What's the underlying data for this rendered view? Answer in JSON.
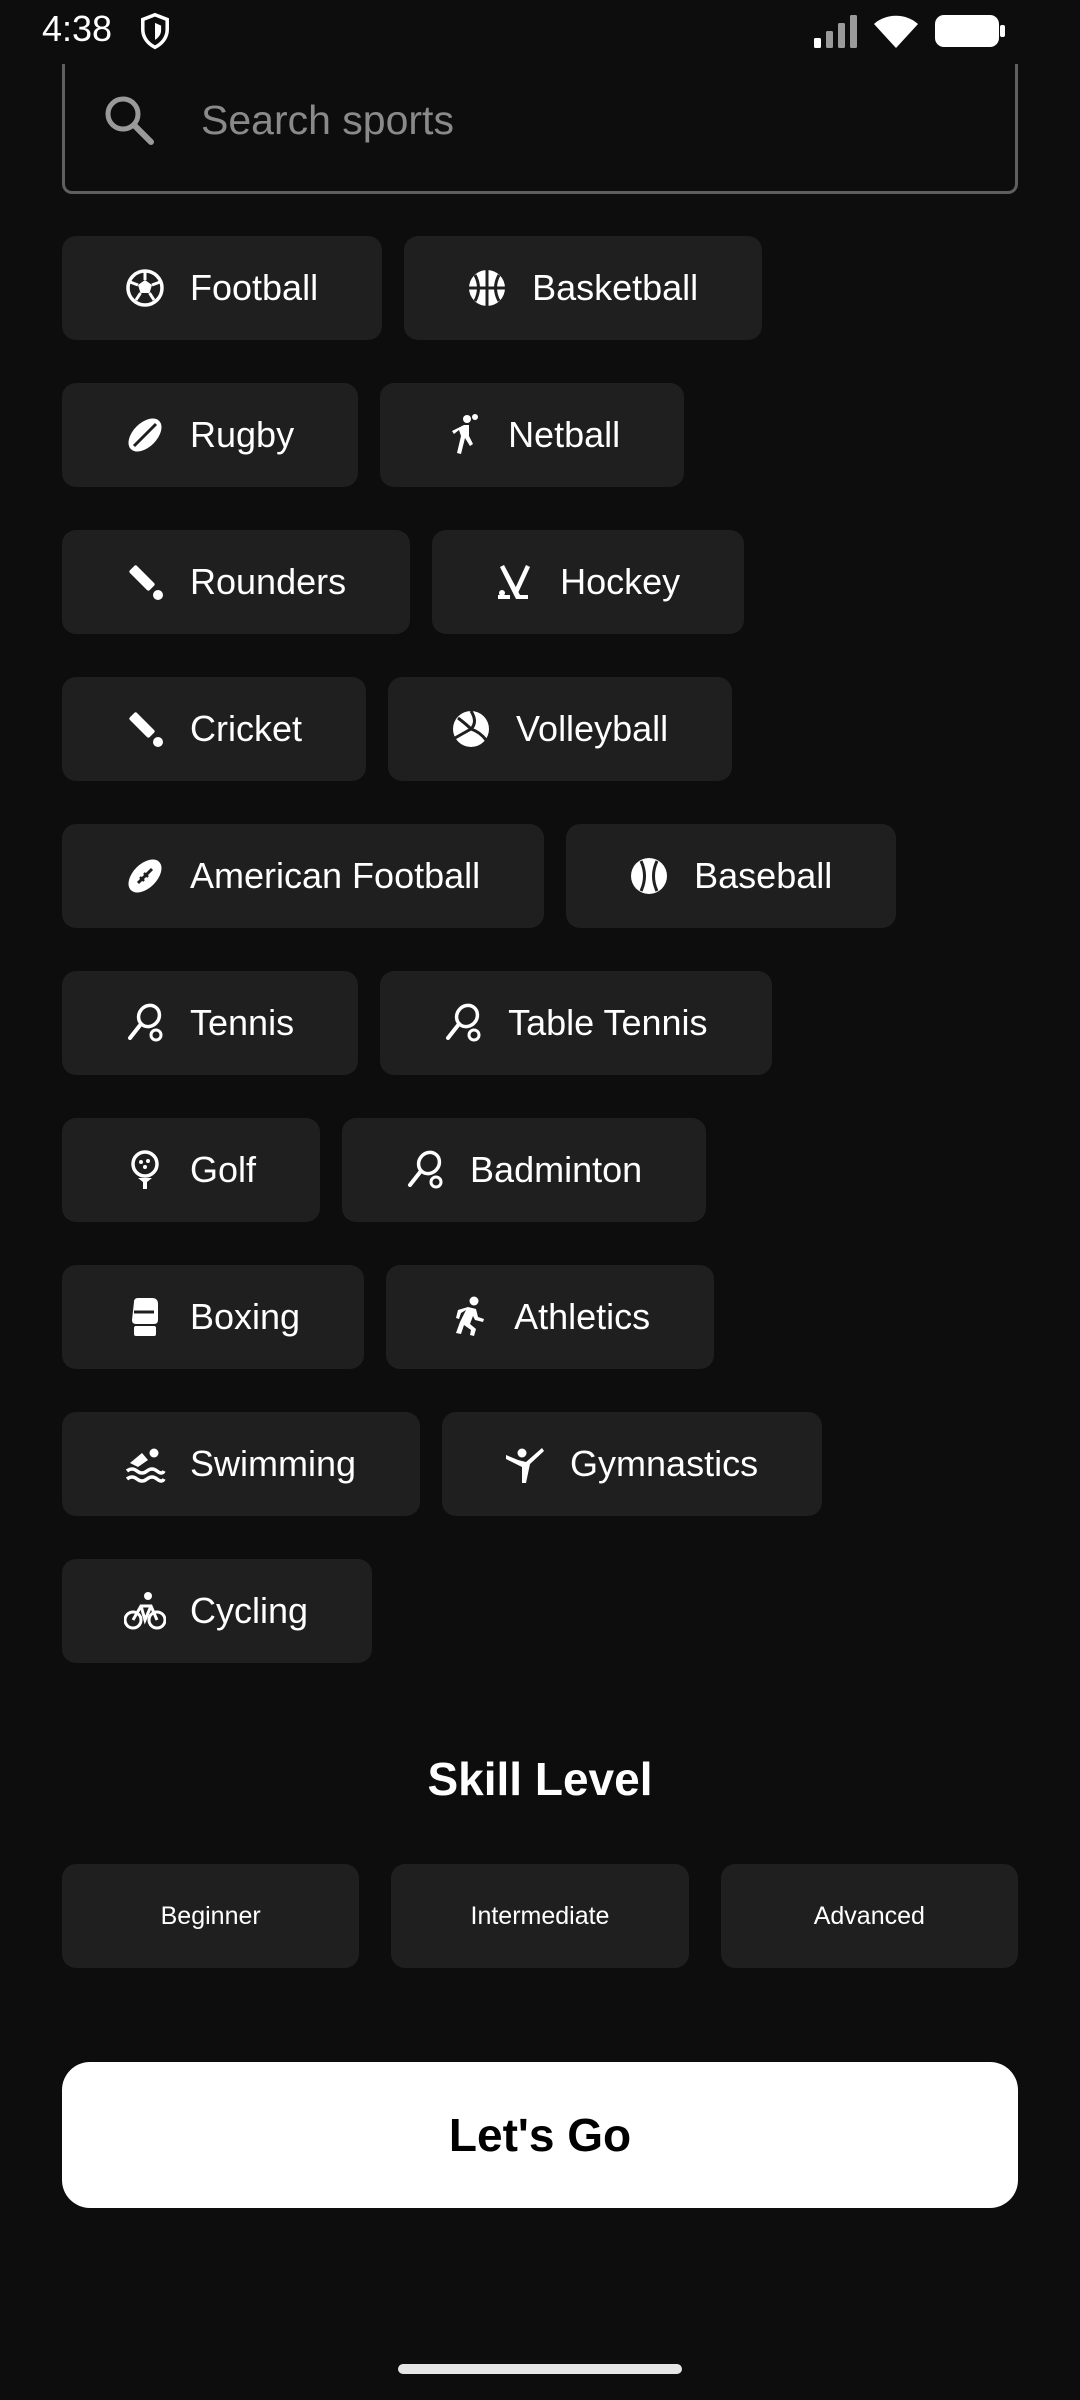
{
  "status_bar": {
    "time": "4:38",
    "icons": [
      "shield-icon",
      "signal-icon",
      "wifi-icon",
      "battery-icon"
    ]
  },
  "search": {
    "placeholder": "Search sports",
    "value": ""
  },
  "sports_rows": [
    [
      {
        "label": "Football",
        "icon": "soccer-ball-icon"
      },
      {
        "label": "Basketball",
        "icon": "basketball-icon"
      }
    ],
    [
      {
        "label": "Rugby",
        "icon": "rugby-ball-icon"
      },
      {
        "label": "Netball",
        "icon": "netball-player-icon"
      }
    ],
    [
      {
        "label": "Rounders",
        "icon": "bat-ball-icon"
      },
      {
        "label": "Hockey",
        "icon": "hockey-sticks-icon"
      }
    ],
    [
      {
        "label": "Cricket",
        "icon": "bat-ball-icon"
      },
      {
        "label": "Volleyball",
        "icon": "volleyball-icon"
      }
    ],
    [
      {
        "label": "American Football",
        "icon": "american-football-icon"
      },
      {
        "label": "Baseball",
        "icon": "baseball-icon"
      }
    ],
    [
      {
        "label": "Tennis",
        "icon": "racket-icon"
      },
      {
        "label": "Table Tennis",
        "icon": "racket-icon"
      }
    ],
    [
      {
        "label": "Golf",
        "icon": "golf-ball-tee-icon"
      },
      {
        "label": "Badminton",
        "icon": "racket-icon"
      }
    ],
    [
      {
        "label": "Boxing",
        "icon": "boxing-glove-icon"
      },
      {
        "label": "Athletics",
        "icon": "runner-icon"
      }
    ],
    [
      {
        "label": "Swimming",
        "icon": "swimmer-icon"
      },
      {
        "label": "Gymnastics",
        "icon": "gymnast-icon"
      }
    ],
    [
      {
        "label": "Cycling",
        "icon": "bicycle-icon"
      }
    ]
  ],
  "skill": {
    "title": "Skill Level",
    "levels": [
      "Beginner",
      "Intermediate",
      "Advanced"
    ]
  },
  "cta": {
    "label": "Let's Go"
  },
  "colors": {
    "background": "#0d0d0d",
    "chip": "#1f1f1f",
    "text": "#ffffff",
    "cta_bg": "#ffffff",
    "cta_text": "#000000"
  }
}
